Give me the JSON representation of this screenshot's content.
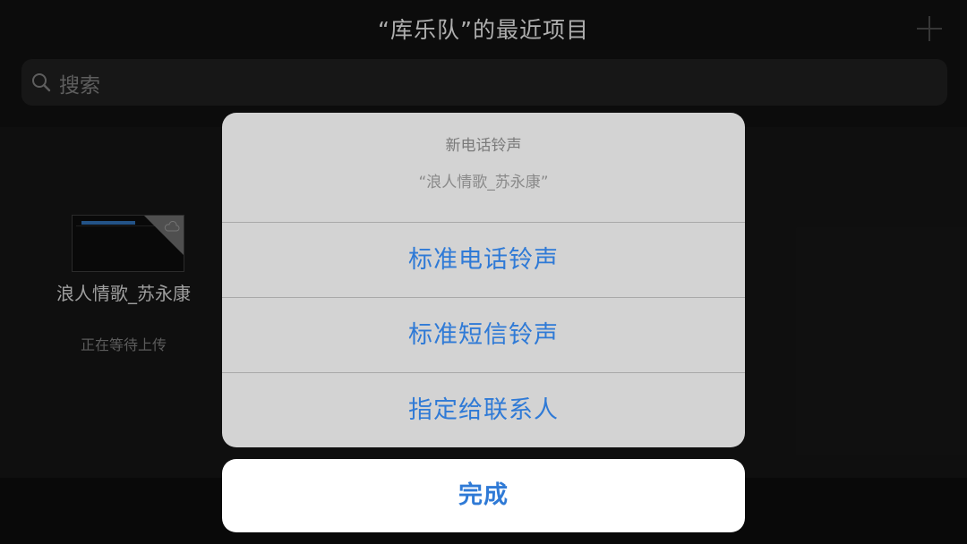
{
  "header": {
    "title": "“库乐队”的最近项目",
    "plus_icon": "plus-icon"
  },
  "search": {
    "placeholder": "搜索",
    "icon": "search-icon"
  },
  "file": {
    "name": "浪人情歌_苏永康",
    "status": "正在等待上传"
  },
  "sheet": {
    "title": "新电话铃声",
    "subtitle": "“浪人情歌_苏永康”",
    "options": [
      {
        "label": "标准电话铃声"
      },
      {
        "label": "标准短信铃声"
      },
      {
        "label": "指定给联系人"
      }
    ],
    "done_label": "完成"
  },
  "colors": {
    "accent": "#2f7ad6",
    "sheet_bg": "#d3d3d3",
    "background": "#141414"
  }
}
